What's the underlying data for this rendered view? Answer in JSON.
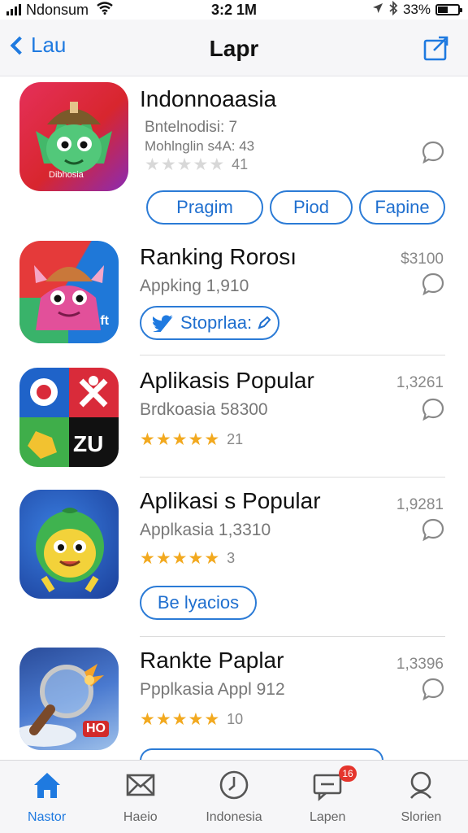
{
  "status_bar": {
    "carrier": "Ndonsum",
    "time": "3:2 1M",
    "battery": "33%"
  },
  "nav": {
    "back_label": "Lau",
    "title": "Lapr"
  },
  "apps": [
    {
      "name": "Indonnoaasia",
      "line1": "Bntelnodisi: 7",
      "line2": "Mohlnglin s4A: 43",
      "stars_filled": 0,
      "rating_count": "41",
      "icon_caption": "Dibhosia",
      "buttons": [
        "Pragim",
        "Piod",
        "Fapine"
      ]
    },
    {
      "name": "Ranking Rorosı",
      "line1": "Appking  1,910",
      "price": "$3100",
      "icon_caption": "ft",
      "share_button": "Stoprlaa:"
    },
    {
      "name": "Aplikasis Popular",
      "line1": "Brdkoasia  58300",
      "price": "1,3261",
      "stars_filled": 5,
      "rating_count": "21",
      "icon_caption": "ZU"
    },
    {
      "name": "Aplikasi s Popular",
      "line1": "Applkasia  1,3310",
      "price": "1,9281",
      "stars_filled": 5,
      "rating_count": "3",
      "button": "Be lyacios"
    },
    {
      "name": "Rankte Paplar",
      "line1": "Ppplkasia  Appl 912",
      "price": "1,3396",
      "stars_filled": 5,
      "rating_count": "10",
      "icon_caption": "HO"
    }
  ],
  "tabs": [
    {
      "label": "Nastor",
      "icon": "home-icon",
      "active": true
    },
    {
      "label": "Haeio",
      "icon": "mail-icon",
      "active": false
    },
    {
      "label": "Indonesia",
      "icon": "clock-icon",
      "active": false
    },
    {
      "label": "Lapen",
      "icon": "message-icon",
      "active": false,
      "badge": "16"
    },
    {
      "label": "Slorien",
      "icon": "search-icon",
      "active": false
    }
  ],
  "colors": {
    "accent": "#1f7ae0",
    "star": "#f2a91f",
    "badge": "#e5352d"
  }
}
